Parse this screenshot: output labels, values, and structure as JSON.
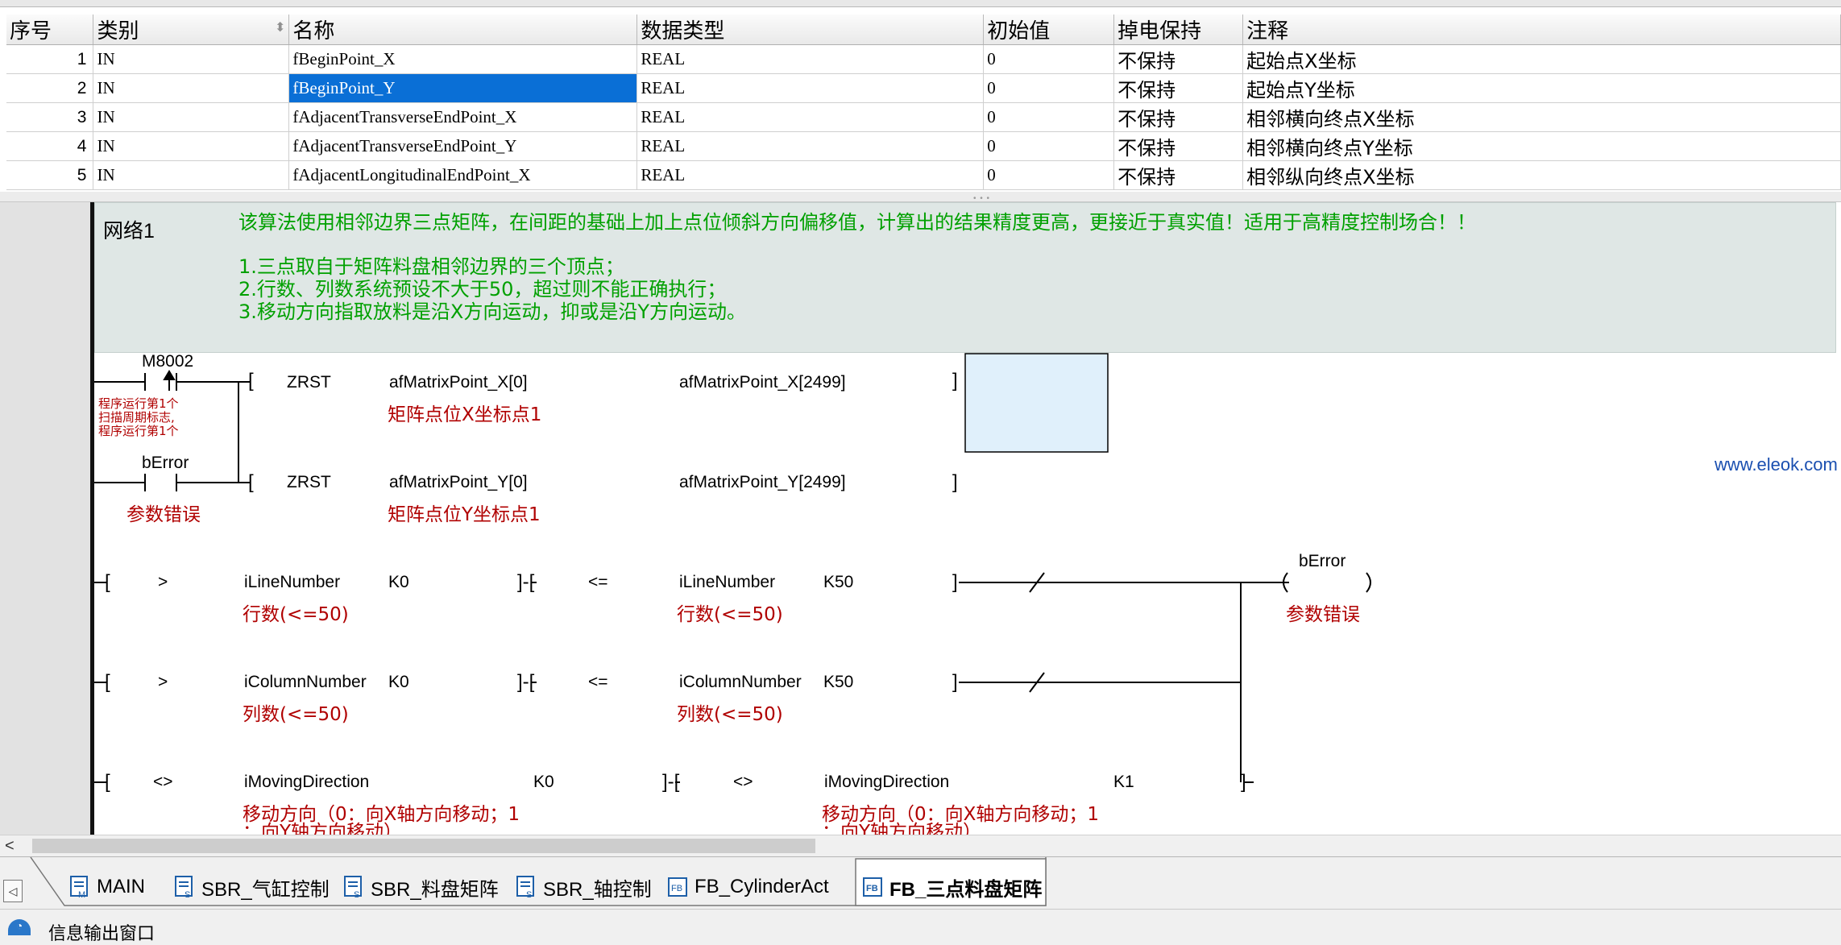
{
  "var_table": {
    "columns": [
      "序号",
      "类别",
      "名称",
      "数据类型",
      "初始值",
      "掉电保持",
      "注释"
    ],
    "rows": [
      {
        "idx": "1",
        "category": "IN",
        "name": "fBeginPoint_X",
        "type": "REAL",
        "init": "0",
        "retain": "不保持",
        "comment": "起始点X坐标"
      },
      {
        "idx": "2",
        "category": "IN",
        "name": "fBeginPoint_Y",
        "type": "REAL",
        "init": "0",
        "retain": "不保持",
        "comment": "起始点Y坐标"
      },
      {
        "idx": "3",
        "category": "IN",
        "name": "fAdjacentTransverseEndPoint_X",
        "type": "REAL",
        "init": "0",
        "retain": "不保持",
        "comment": "相邻横向终点X坐标"
      },
      {
        "idx": "4",
        "category": "IN",
        "name": "fAdjacentTransverseEndPoint_Y",
        "type": "REAL",
        "init": "0",
        "retain": "不保持",
        "comment": "相邻横向终点Y坐标"
      },
      {
        "idx": "5",
        "category": "IN",
        "name": "fAdjacentLongitudinalEndPoint_X",
        "type": "REAL",
        "init": "0",
        "retain": "不保持",
        "comment": "相邻纵向终点X坐标"
      }
    ],
    "selected_row": 2
  },
  "network": {
    "label": "网络1",
    "comment_lines": [
      "该算法使用相邻边界三点矩阵，在间距的基础上加上点位倾斜方向偏移值，计算出的结果精度更高，更接近于真实值！适用于高精度控制场合！！",
      "1.三点取自于矩阵料盘相邻边界的三个顶点；",
      "2.行数、列数系统预设不大于50，超过则不能正确执行；",
      "3.移动方向指取放料是沿X方向运动，抑或是沿Y方向运动。"
    ]
  },
  "ladder": {
    "m8002": "M8002",
    "m8002_comment": [
      "程序运行第1个",
      "扫描周期标志,",
      "程序运行第1个"
    ],
    "berror_contact": "bError",
    "berror_contact_comment": "参数错误",
    "zrst1": {
      "op": "ZRST",
      "arg1": "afMatrixPoint_X[0]",
      "arg1_comment": "矩阵点位X坐标点1",
      "arg2": "afMatrixPoint_X[2499]"
    },
    "zrst2": {
      "op": "ZRST",
      "arg1": "afMatrixPoint_Y[0]",
      "arg1_comment": "矩阵点位Y坐标点1",
      "arg2": "afMatrixPoint_Y[2499]"
    },
    "row3": {
      "op1": ">",
      "var1": "iLineNumber",
      "k1": "K0",
      "var1_comment": "行数(<=50)",
      "op2": "<=",
      "var2": "iLineNumber",
      "k2": "K50",
      "var2_comment": "行数(<=50)"
    },
    "row4": {
      "op1": ">",
      "var1": "iColumnNumber",
      "k1": "K0",
      "var1_comment": "列数(<=50)",
      "op2": "<=",
      "var2": "iColumnNumber",
      "k2": "K50",
      "var2_comment": "列数(<=50)"
    },
    "row5": {
      "op1": "<>",
      "var1": "iMovingDirection",
      "k1": "K0",
      "var1_comment": "移动方向（0：向X轴方向移动；1",
      "var1_comment2": "：向Y轴方向移动）",
      "op2": "<>",
      "var2": "iMovingDirection",
      "k2": "K1",
      "var2_comment": "移动方向（0：向X轴方向移动；1",
      "var2_comment2": "：向Y轴方向移动）"
    },
    "coil": "bError",
    "coil_comment": "参数错误",
    "watermark": "www.eleok.com"
  },
  "tabs": [
    {
      "label": "MAIN",
      "icon_letter": "M",
      "active": false
    },
    {
      "label": "SBR_气缸控制",
      "icon_letter": "S",
      "active": false
    },
    {
      "label": "SBR_料盘矩阵",
      "icon_letter": "S",
      "active": false
    },
    {
      "label": "SBR_轴控制",
      "icon_letter": "S",
      "active": false
    },
    {
      "label": "FB_CylinderAct",
      "icon_letter": "FB",
      "active": false
    },
    {
      "label": "FB_三点料盘矩阵",
      "icon_letter": "FB",
      "active": true
    }
  ],
  "tab_nav_glyph": "◁",
  "status": {
    "text": "信息输出窗口"
  },
  "colors": {
    "selection": "#0a6fd6",
    "comment_green": "#00a000",
    "label_red": "#b00000",
    "watermark_blue": "#1a4fb0"
  }
}
